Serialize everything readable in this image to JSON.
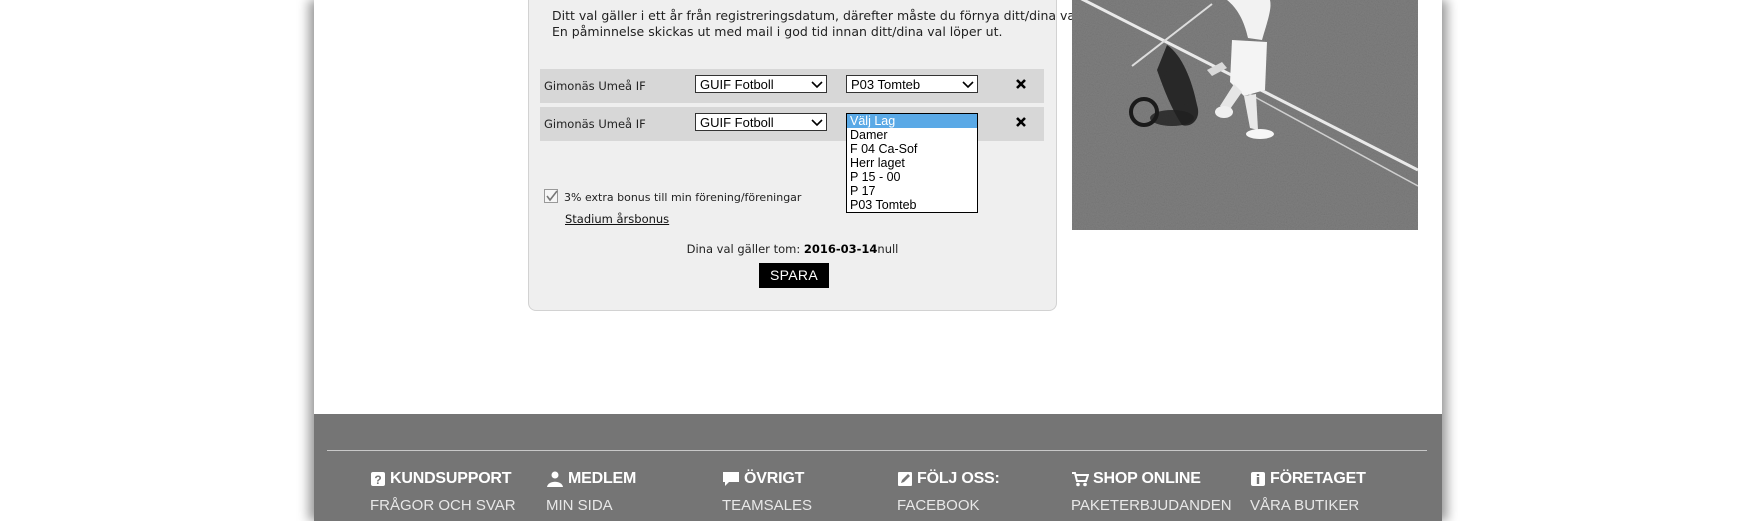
{
  "info": {
    "line1": "Ditt val gäller i ett år från registreringsdatum, därefter måste du förnya ditt/dina val.",
    "line2": "En påminnelse skickas ut med mail i god tid innan ditt/dina val löper ut."
  },
  "selections": [
    {
      "club_name": "Gimonäs Umeå IF",
      "association": "GUIF Fotboll",
      "team": "P03 Tomteb"
    },
    {
      "club_name": "Gimonäs Umeå IF",
      "association": "GUIF Fotboll",
      "team": "Välj Lag"
    }
  ],
  "team_dropdown": {
    "options": [
      "Välj Lag",
      "Damer",
      "F 04 Ca-Sof",
      "Herr laget",
      "P 15 - 00",
      "P 17",
      "P03 Tomteb"
    ],
    "highlighted": "Välj Lag"
  },
  "bonus": {
    "checkbox_label": "3% extra bonus till min förening/föreningar",
    "checked": true,
    "link_label": "Stadium årsbonus"
  },
  "validity": {
    "prefix": "Dina val gäller tom: ",
    "date": "2016-03-14",
    "suffix": "null"
  },
  "save_label": "SPARA",
  "footer": {
    "columns": [
      {
        "icon": "question-icon",
        "title": "KUNDSUPPORT",
        "link": "FRÅGOR OCH SVAR"
      },
      {
        "icon": "person-icon",
        "title": "MEDLEM",
        "link": "MIN SIDA"
      },
      {
        "icon": "speech-bubble-icon",
        "title": "ÖVRIGT",
        "link": "TEAMSALES"
      },
      {
        "icon": "edit-icon",
        "title": "FÖLJ OSS:",
        "link": "FACEBOOK"
      },
      {
        "icon": "cart-icon",
        "title": "SHOP ONLINE",
        "link": "PAKETERBJUDANDEN"
      },
      {
        "icon": "info-icon",
        "title": "FÖRETAGET",
        "link": "VÅRA BUTIKER"
      }
    ]
  },
  "colors": {
    "footer_bg": "#757575",
    "panel_bg": "#efefef",
    "row_bg": "#d7d7d7",
    "dropdown_highlight": "#5aa9e6",
    "button_bg": "#000000"
  }
}
